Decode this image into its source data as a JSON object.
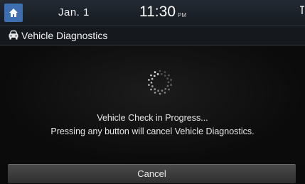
{
  "status_bar": {
    "date": "Jan.  1",
    "time": "11:30",
    "ampm": "PM",
    "home_icon": "home-icon",
    "edge_icon": "signal-icon"
  },
  "title_bar": {
    "icon": "car-icon",
    "title": "Vehicle Diagnostics"
  },
  "main": {
    "spinner_icon": "loading-spinner-icon",
    "message_line1": "Vehicle Check in Progress...",
    "message_line2": "Pressing any button will cancel Vehicle Diagnostics."
  },
  "footer": {
    "cancel_label": "Cancel"
  },
  "colors": {
    "home_button": "#3d6fb0",
    "background": "#0a0a0a",
    "text": "#e8e8e8"
  }
}
